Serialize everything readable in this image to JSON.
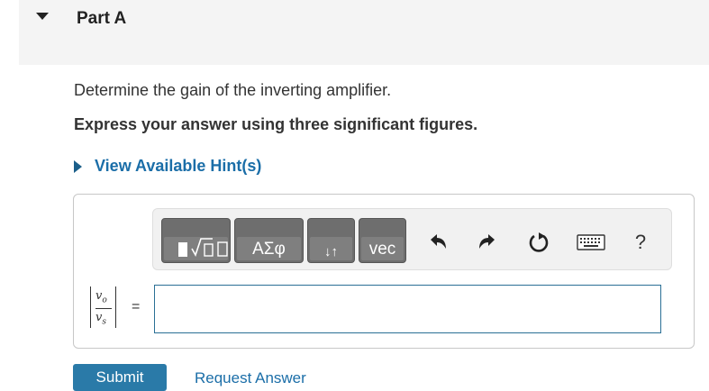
{
  "part": {
    "title": "Part A"
  },
  "question": {
    "text": "Determine the gain of the inverting amplifier.",
    "instruction": "Express your answer using three significant figures."
  },
  "hint": {
    "label": "View Available Hint(s)"
  },
  "toolbar": {
    "templates_label": "",
    "greek_label": "ΑΣφ",
    "arrows_label": "↓↑",
    "vec_label": "vec",
    "undo_icon": "undo-icon",
    "redo_icon": "redo-icon",
    "reset_icon": "reset-icon",
    "keyboard_icon": "keyboard-icon",
    "help_label": "?"
  },
  "equation": {
    "numerator": "vo",
    "denominator": "vs",
    "equals": "="
  },
  "answer": {
    "value": "",
    "placeholder": ""
  },
  "actions": {
    "submit_label": "Submit",
    "request_label": "Request Answer"
  }
}
